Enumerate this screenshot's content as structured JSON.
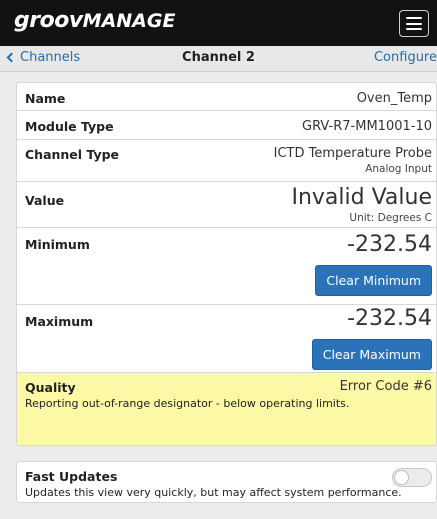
{
  "header": {
    "logo_part1": "groov",
    "logo_part2": "MANAGE",
    "menu_icon": "hamburger-menu-icon"
  },
  "nav": {
    "back_label": "Channels",
    "title": "Channel 2",
    "configure_label": "Configure"
  },
  "details": {
    "name": {
      "label": "Name",
      "value": "Oven_Temp"
    },
    "module_type": {
      "label": "Module Type",
      "value": "GRV-R7-MM1001-10"
    },
    "channel_type": {
      "label": "Channel Type",
      "value": "ICTD Temperature Probe",
      "sub": "Analog Input"
    },
    "value": {
      "label": "Value",
      "value": "Invalid Value",
      "unit": "Unit: Degrees C"
    },
    "minimum": {
      "label": "Minimum",
      "value": "-232.54",
      "button": "Clear Minimum"
    },
    "maximum": {
      "label": "Maximum",
      "value": "-232.54",
      "button": "Clear Maximum"
    },
    "quality": {
      "label": "Quality",
      "code": "Error Code #6",
      "description": "Reporting out-of-range designator - below operating limits."
    }
  },
  "fast_updates": {
    "label": "Fast Updates",
    "description": "Updates this view very quickly, but may affect system performance.",
    "enabled": false
  },
  "colors": {
    "top_bar": "#121212",
    "link": "#1f6fb2",
    "button": "#2a73b8",
    "quality_background": "#fbf9a5"
  }
}
